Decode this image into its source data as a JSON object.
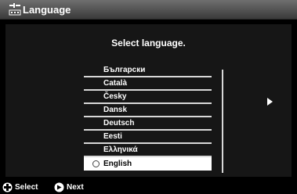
{
  "header": {
    "title": "Language",
    "icon": "settings-icon"
  },
  "main": {
    "prompt": "Select language."
  },
  "languages": [
    {
      "label": "Български",
      "selected": false
    },
    {
      "label": "Català",
      "selected": false
    },
    {
      "label": "Česky",
      "selected": false
    },
    {
      "label": "Dansk",
      "selected": false
    },
    {
      "label": "Deutsch",
      "selected": false
    },
    {
      "label": "Eesti",
      "selected": false
    },
    {
      "label": "Ελληνικά",
      "selected": false
    },
    {
      "label": "English",
      "selected": true
    }
  ],
  "footer": {
    "select_label": "Select",
    "next_label": "Next",
    "select_icon": "dpad-icon",
    "next_icon": "next-arrow-icon"
  },
  "colors": {
    "background": "#000000",
    "panel": "#161616",
    "highlight": "#ffffff"
  }
}
